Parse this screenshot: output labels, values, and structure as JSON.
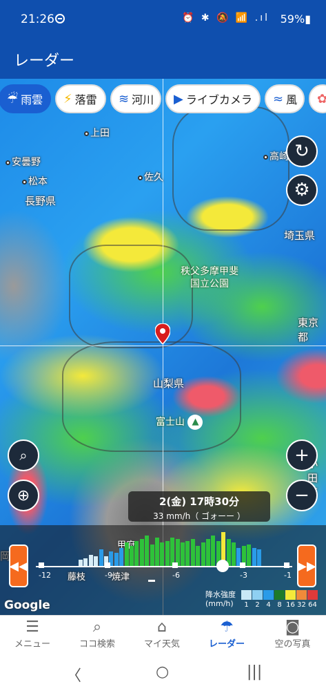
{
  "status_bar": {
    "time": "21:26",
    "icons": "⏰ ✱ 🔕 📶 .ıl",
    "battery": "59%▮"
  },
  "app_bar": {
    "title": "レーダー"
  },
  "layer_tabs": [
    {
      "label": "雨雲",
      "icon": "rain-cloud-icon",
      "active": true
    },
    {
      "label": "落雷",
      "icon": "lightning-icon",
      "active": false
    },
    {
      "label": "河川",
      "icon": "river-icon",
      "active": false
    },
    {
      "label": "ライブカメラ",
      "icon": "camera-icon",
      "active": false
    },
    {
      "label": "風",
      "icon": "wind-icon",
      "active": false
    }
  ],
  "map": {
    "places": [
      "上田",
      "安曇野",
      "松本",
      "佐久",
      "高崎"
    ],
    "prefectures": [
      "長野県",
      "埼玉県",
      "東京都",
      "山梨県",
      "岡県",
      "小田原"
    ],
    "park": [
      "秩父多摩甲斐",
      "国立公園"
    ],
    "mountain": "富士山",
    "underlabels": [
      "藤枝",
      "焼津",
      "甲府"
    ],
    "attribution": "Google"
  },
  "timestamp": {
    "datetime": "2(金) 17時30分",
    "intensity": "33 mm/h（ ゴォーー ）"
  },
  "timeline": {
    "tick_labels": [
      "-12",
      "-9",
      "-6",
      "-3",
      "-1"
    ],
    "bars": [
      0.2,
      0.25,
      0.35,
      0.3,
      0.5,
      0.3,
      0.45,
      0.4,
      0.55,
      0.7,
      0.6,
      0.75,
      0.8,
      0.9,
      0.65,
      0.85,
      0.7,
      0.75,
      0.85,
      0.8,
      0.7,
      0.75,
      0.8,
      0.6,
      0.7,
      0.8,
      0.9,
      0.75,
      1.0,
      0.8,
      0.7,
      0.55,
      0.6,
      0.65,
      0.55,
      0.5
    ]
  },
  "legend": {
    "title": "降水強度\n(mm/h)",
    "steps": [
      {
        "label": "1",
        "color": "#c8e8f6"
      },
      {
        "label": "2",
        "color": "#8fd0f2"
      },
      {
        "label": "4",
        "color": "#2a9be8"
      },
      {
        "label": "8",
        "color": "#1d7a2a"
      },
      {
        "label": "16",
        "color": "#f4e93a"
      },
      {
        "label": "32",
        "color": "#f08a3a"
      },
      {
        "label": "64",
        "color": "#e03a3a"
      }
    ]
  },
  "bottom_nav": [
    {
      "label": "メニュー",
      "icon": "menu-icon"
    },
    {
      "label": "ココ検索",
      "icon": "search-icon"
    },
    {
      "label": "マイ天気",
      "icon": "home-icon"
    },
    {
      "label": "レーダー",
      "icon": "umbrella-icon",
      "active": true
    },
    {
      "label": "空の写真",
      "icon": "photo-camera-icon"
    }
  ],
  "sys_nav": {
    "back": "〈",
    "home": "○",
    "recents": "|||"
  }
}
